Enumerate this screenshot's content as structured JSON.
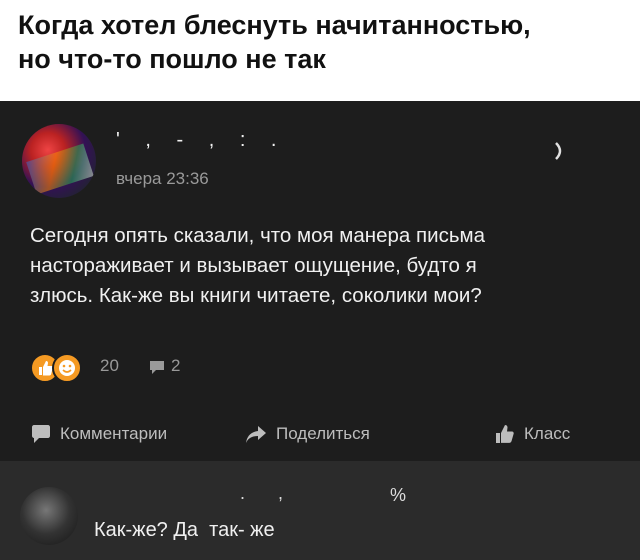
{
  "meme": {
    "title_lines": [
      "Когда хотел блеснуть начитанностью,",
      "но что-то пошло не так"
    ]
  },
  "post": {
    "author": "'   ,   -   ,   :   .",
    "time": "вчера 23:36",
    "text_lines": [
      "Сегодня опять сказали, что моя манера письма",
      "настораживает и вызывает ощущение, будто я",
      "злюсь. Как-же вы книги читаете, соколики мои?"
    ],
    "reactions": {
      "icons": [
        "like-icon",
        "smile-icon"
      ],
      "count": "20"
    },
    "comments_count": "2",
    "actions": {
      "comment_label": "Комментарии",
      "share_label": "Поделиться",
      "class_label": "Класс"
    }
  },
  "reply": {
    "author": ".     ,",
    "mark": "%",
    "text": "Как-же? Да  так- же"
  },
  "colors": {
    "background_dark": "#1d1d1d",
    "reply_background": "#2b2b2b",
    "accent_orange": "#f59a23",
    "text_light": "#f0f0f0",
    "text_muted": "#9a9a9a"
  }
}
